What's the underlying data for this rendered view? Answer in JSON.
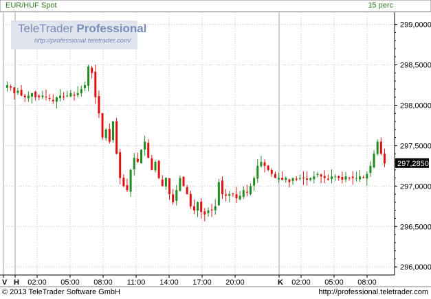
{
  "header": {
    "instrument": "EUR/HUF Spot",
    "interval": "15 perc"
  },
  "watermark": {
    "brand": "TeleTrader",
    "product": "Professional",
    "url": "http://professional.teletrader.com/"
  },
  "footer": {
    "copyright": "© 2013 TeleTrader Software GmbH",
    "url": "http://professional.teletrader.com"
  },
  "colors": {
    "up": "#1e8c1e",
    "down": "#e01010",
    "grid": "#c8c8c8",
    "header_text": "#2e7d1e",
    "last_price_box": "#000000"
  },
  "chart_data": {
    "type": "candlestick",
    "ylim": [
      295.9,
      299.15
    ],
    "y_ticks": [
      "299,0000",
      "298,5000",
      "298,0000",
      "297,5000",
      "297,0000",
      "296,5000",
      "296,0000"
    ],
    "y_tick_values": [
      299.0,
      298.5,
      298.0,
      297.5,
      297.0,
      296.5,
      296.0
    ],
    "x_ticks": [
      "V",
      "H",
      "02:00",
      "05:00",
      "08:00",
      "11:00",
      "14:00",
      "17:00",
      "20:00",
      "K",
      "02:00",
      "05:00",
      "08:00"
    ],
    "day_separators": [
      "V",
      "H",
      "K"
    ],
    "last_price": "297,2850",
    "last_price_value": 297.285,
    "close_path": [
      298.25,
      298.22,
      298.15,
      298.18,
      298.12,
      298.1,
      298.12,
      298.15,
      298.1,
      298.1,
      298.12,
      298.1,
      298.08,
      298.05,
      298.1,
      298.12,
      298.1,
      298.12,
      298.15,
      298.12,
      298.15,
      298.2,
      298.25,
      298.48,
      298.4,
      298.1,
      297.9,
      297.6,
      297.7,
      297.55,
      297.8,
      297.4,
      297.1,
      297.0,
      296.95,
      297.2,
      297.35,
      297.3,
      297.45,
      297.55,
      297.35,
      297.2,
      297.3,
      297.1,
      297.0,
      297.1,
      296.9,
      296.8,
      296.95,
      297.1,
      297.0,
      296.9,
      296.75,
      296.7,
      296.8,
      296.68,
      296.65,
      296.7,
      296.7,
      296.75,
      297.05,
      296.9,
      296.88,
      296.9,
      296.9,
      296.85,
      296.88,
      296.95,
      296.92,
      297.0,
      297.1,
      297.25,
      297.3,
      297.25,
      297.2,
      297.15,
      297.1,
      297.1,
      297.08,
      297.1,
      297.05,
      297.1,
      297.08,
      297.1,
      297.1,
      297.08,
      297.1,
      297.12,
      297.15,
      297.12,
      297.1,
      297.08,
      297.12,
      297.12,
      297.1,
      297.08,
      297.12,
      297.1,
      297.1,
      297.1,
      297.12,
      297.1,
      297.15,
      297.25,
      297.4,
      297.55,
      297.4,
      297.28
    ]
  }
}
